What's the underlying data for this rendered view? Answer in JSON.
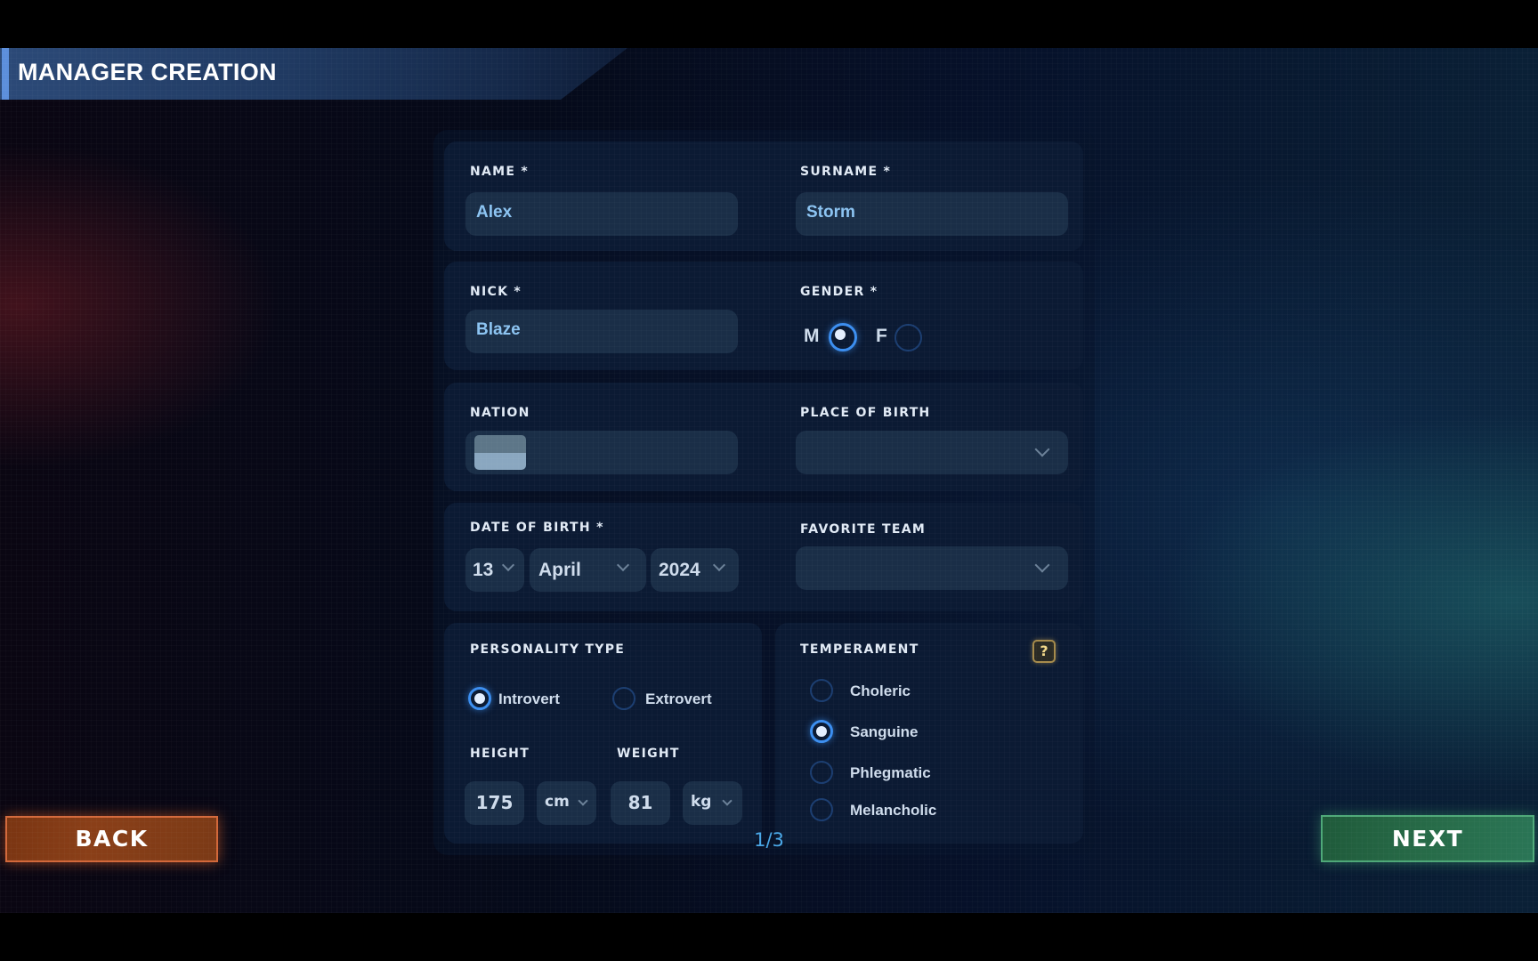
{
  "header": {
    "title": "MANAGER CREATION"
  },
  "form": {
    "name": {
      "label": "NAME *",
      "value": "Alex"
    },
    "surname": {
      "label": "SURNAME *",
      "value": "Storm"
    },
    "nick": {
      "label": "NICK *",
      "value": "Blaze"
    },
    "gender": {
      "label": "GENDER *",
      "options": [
        {
          "label": "M",
          "checked": true
        },
        {
          "label": "F",
          "checked": false
        }
      ]
    },
    "nation": {
      "label": "NATION",
      "flag_icon": "flag-placeholder-icon",
      "value": ""
    },
    "place_of_birth": {
      "label": "PLACE OF BIRTH",
      "value": ""
    },
    "date_of_birth": {
      "label": "DATE OF BIRTH *",
      "day": "13",
      "month": "April",
      "year": "2024"
    },
    "favorite_team": {
      "label": "FAVORITE TEAM",
      "value": ""
    },
    "personality_type": {
      "label": "PERSONALITY TYPE",
      "options": [
        {
          "label": "Introvert",
          "checked": true
        },
        {
          "label": "Extrovert",
          "checked": false
        }
      ]
    },
    "height": {
      "label": "HEIGHT",
      "value": "175",
      "unit": "cm"
    },
    "weight": {
      "label": "WEIGHT",
      "value": "81",
      "unit": "kg"
    },
    "temperament": {
      "label": "TEMPERAMENT",
      "help_label": "?",
      "options": [
        {
          "label": "Choleric",
          "checked": false
        },
        {
          "label": "Sanguine",
          "checked": true
        },
        {
          "label": "Phlegmatic",
          "checked": false
        },
        {
          "label": "Melancholic",
          "checked": false
        }
      ]
    }
  },
  "footer": {
    "back_label": "BACK",
    "next_label": "NEXT",
    "page_indicator": "1/3"
  },
  "colors": {
    "accent_blue": "#3b8ef0",
    "value_text": "#8cc4f2",
    "back_button": "#8a3f18",
    "next_button": "#276b48",
    "help_gold": "#a58a4b"
  }
}
